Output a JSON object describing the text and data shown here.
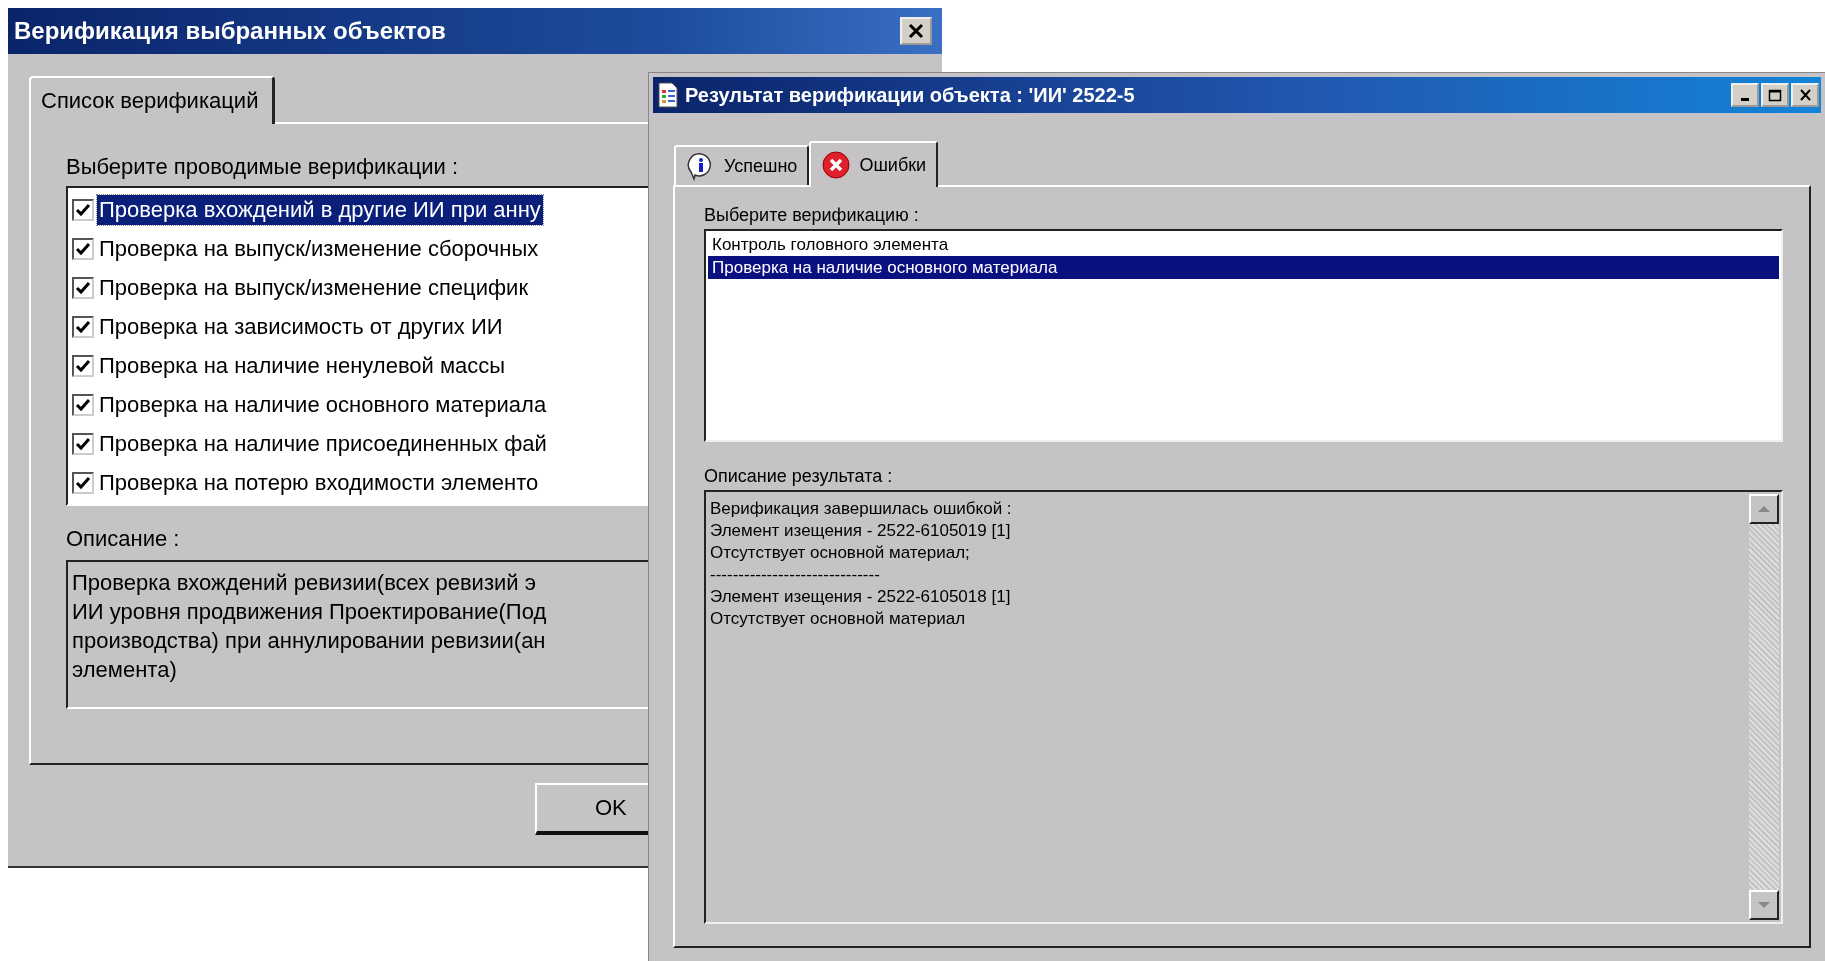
{
  "verification_dialog": {
    "title": "Верификация выбранных объектов",
    "tabs": [
      {
        "label": "Список верификаций",
        "selected": true
      }
    ],
    "list_label": "Выберите проводимые верификации :",
    "checks": [
      {
        "label": "Проверка вхождений в другие ИИ при анну",
        "checked": true,
        "selected": true
      },
      {
        "label": "Проверка на выпуск/изменение сборочных",
        "checked": true,
        "selected": false
      },
      {
        "label": "Проверка на выпуск/изменение специфик",
        "checked": true,
        "selected": false
      },
      {
        "label": "Проверка на зависимость от других ИИ",
        "checked": true,
        "selected": false
      },
      {
        "label": "Проверка на наличие ненулевой массы",
        "checked": true,
        "selected": false
      },
      {
        "label": "Проверка на наличие основного материала",
        "checked": true,
        "selected": false
      },
      {
        "label": "Проверка на наличие присоединенных фай",
        "checked": true,
        "selected": false
      },
      {
        "label": "Проверка на потерю входимости элементо",
        "checked": true,
        "selected": false
      }
    ],
    "description_label": "Описание :",
    "description_lines": [
      "Проверка вхождений ревизии(всех ревизий э",
      "ИИ уровня продвижения Проектирование(Под",
      "производства) при аннулировании ревизии(ан",
      "элемента)"
    ],
    "ok_button": "OK"
  },
  "result_window": {
    "title": "Результат верификации объекта : 'ИИ' 2522-5",
    "tabs": [
      {
        "label": "Успешно",
        "kind": "info",
        "selected": false
      },
      {
        "label": "Ошибки",
        "kind": "error",
        "selected": true
      }
    ],
    "list_label": "Выберите верификацию :",
    "verifications": [
      {
        "label": "Контроль головного элемента",
        "selected": false
      },
      {
        "label": "Проверка на наличие основного материала",
        "selected": true
      }
    ],
    "result_label": "Описание результата :",
    "result_lines": [
      "Верификация завершилась ошибкой :",
      "Элемент изещения - 2522-6105019 [1]",
      "Отсутствует основной материал;",
      "------------------------------",
      "Элемент изещения - 2522-6105018 [1]",
      "Отсутствует основной материал"
    ]
  }
}
